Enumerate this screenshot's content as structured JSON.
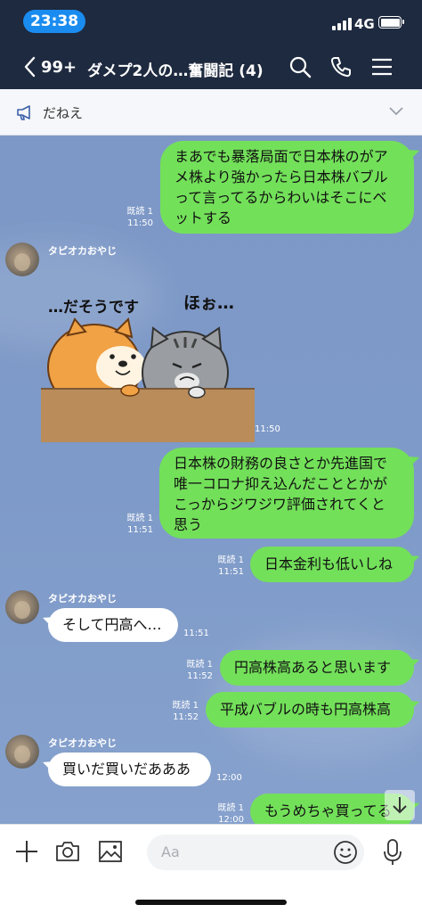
{
  "status": {
    "time": "23:38",
    "network": "4G"
  },
  "header": {
    "back_count": "99+",
    "title": "ダメプ2人の…奮闘記 (4)"
  },
  "announcement": {
    "text": "だねえ"
  },
  "messages": [
    {
      "side": "me",
      "lines": [
        "まあでも暴落局面で日本株のがア",
        "メ株より強かったら日本株バブル",
        "って言ってるからわいはそこにベ",
        "ットする"
      ],
      "read": "既読 1",
      "time": "11:50"
    },
    {
      "side": "other",
      "sender": "タピオカおやじ",
      "sticker": true,
      "time": "11:50",
      "sticker_text_left": "…だそうです",
      "sticker_text_right": "ほぉ…"
    },
    {
      "side": "me",
      "lines": [
        "日本株の財務の良さとか先進国で",
        "唯一コロナ抑え込んだこととかが",
        "こっからジワジワ評価されてくと",
        "思う"
      ],
      "read": "既読 1",
      "time": "11:51"
    },
    {
      "side": "me",
      "lines": [
        "日本金利も低いしね"
      ],
      "read": "既読 1",
      "time": "11:51"
    },
    {
      "side": "other",
      "sender": "タピオカおやじ",
      "lines": [
        "そして円高へ…"
      ],
      "time": "11:51"
    },
    {
      "side": "me",
      "lines": [
        "円高株高あると思います"
      ],
      "read": "既読 1",
      "time": "11:52"
    },
    {
      "side": "me",
      "lines": [
        "平成バブルの時も円高株高"
      ],
      "read": "既読 1",
      "time": "11:52"
    },
    {
      "side": "other",
      "sender": "タピオカおやじ",
      "lines": [
        "買いだ買いだあああ"
      ],
      "time": "12:00"
    },
    {
      "side": "me",
      "lines": [
        "もうめちゃ買ってる"
      ],
      "read": "既読 1",
      "time": "12:00"
    }
  ],
  "input": {
    "placeholder": "Aa"
  },
  "colors": {
    "header_bg": "#1e2a3f",
    "my_bubble": "#73e05a",
    "chat_bg": "#7e9ac8"
  }
}
